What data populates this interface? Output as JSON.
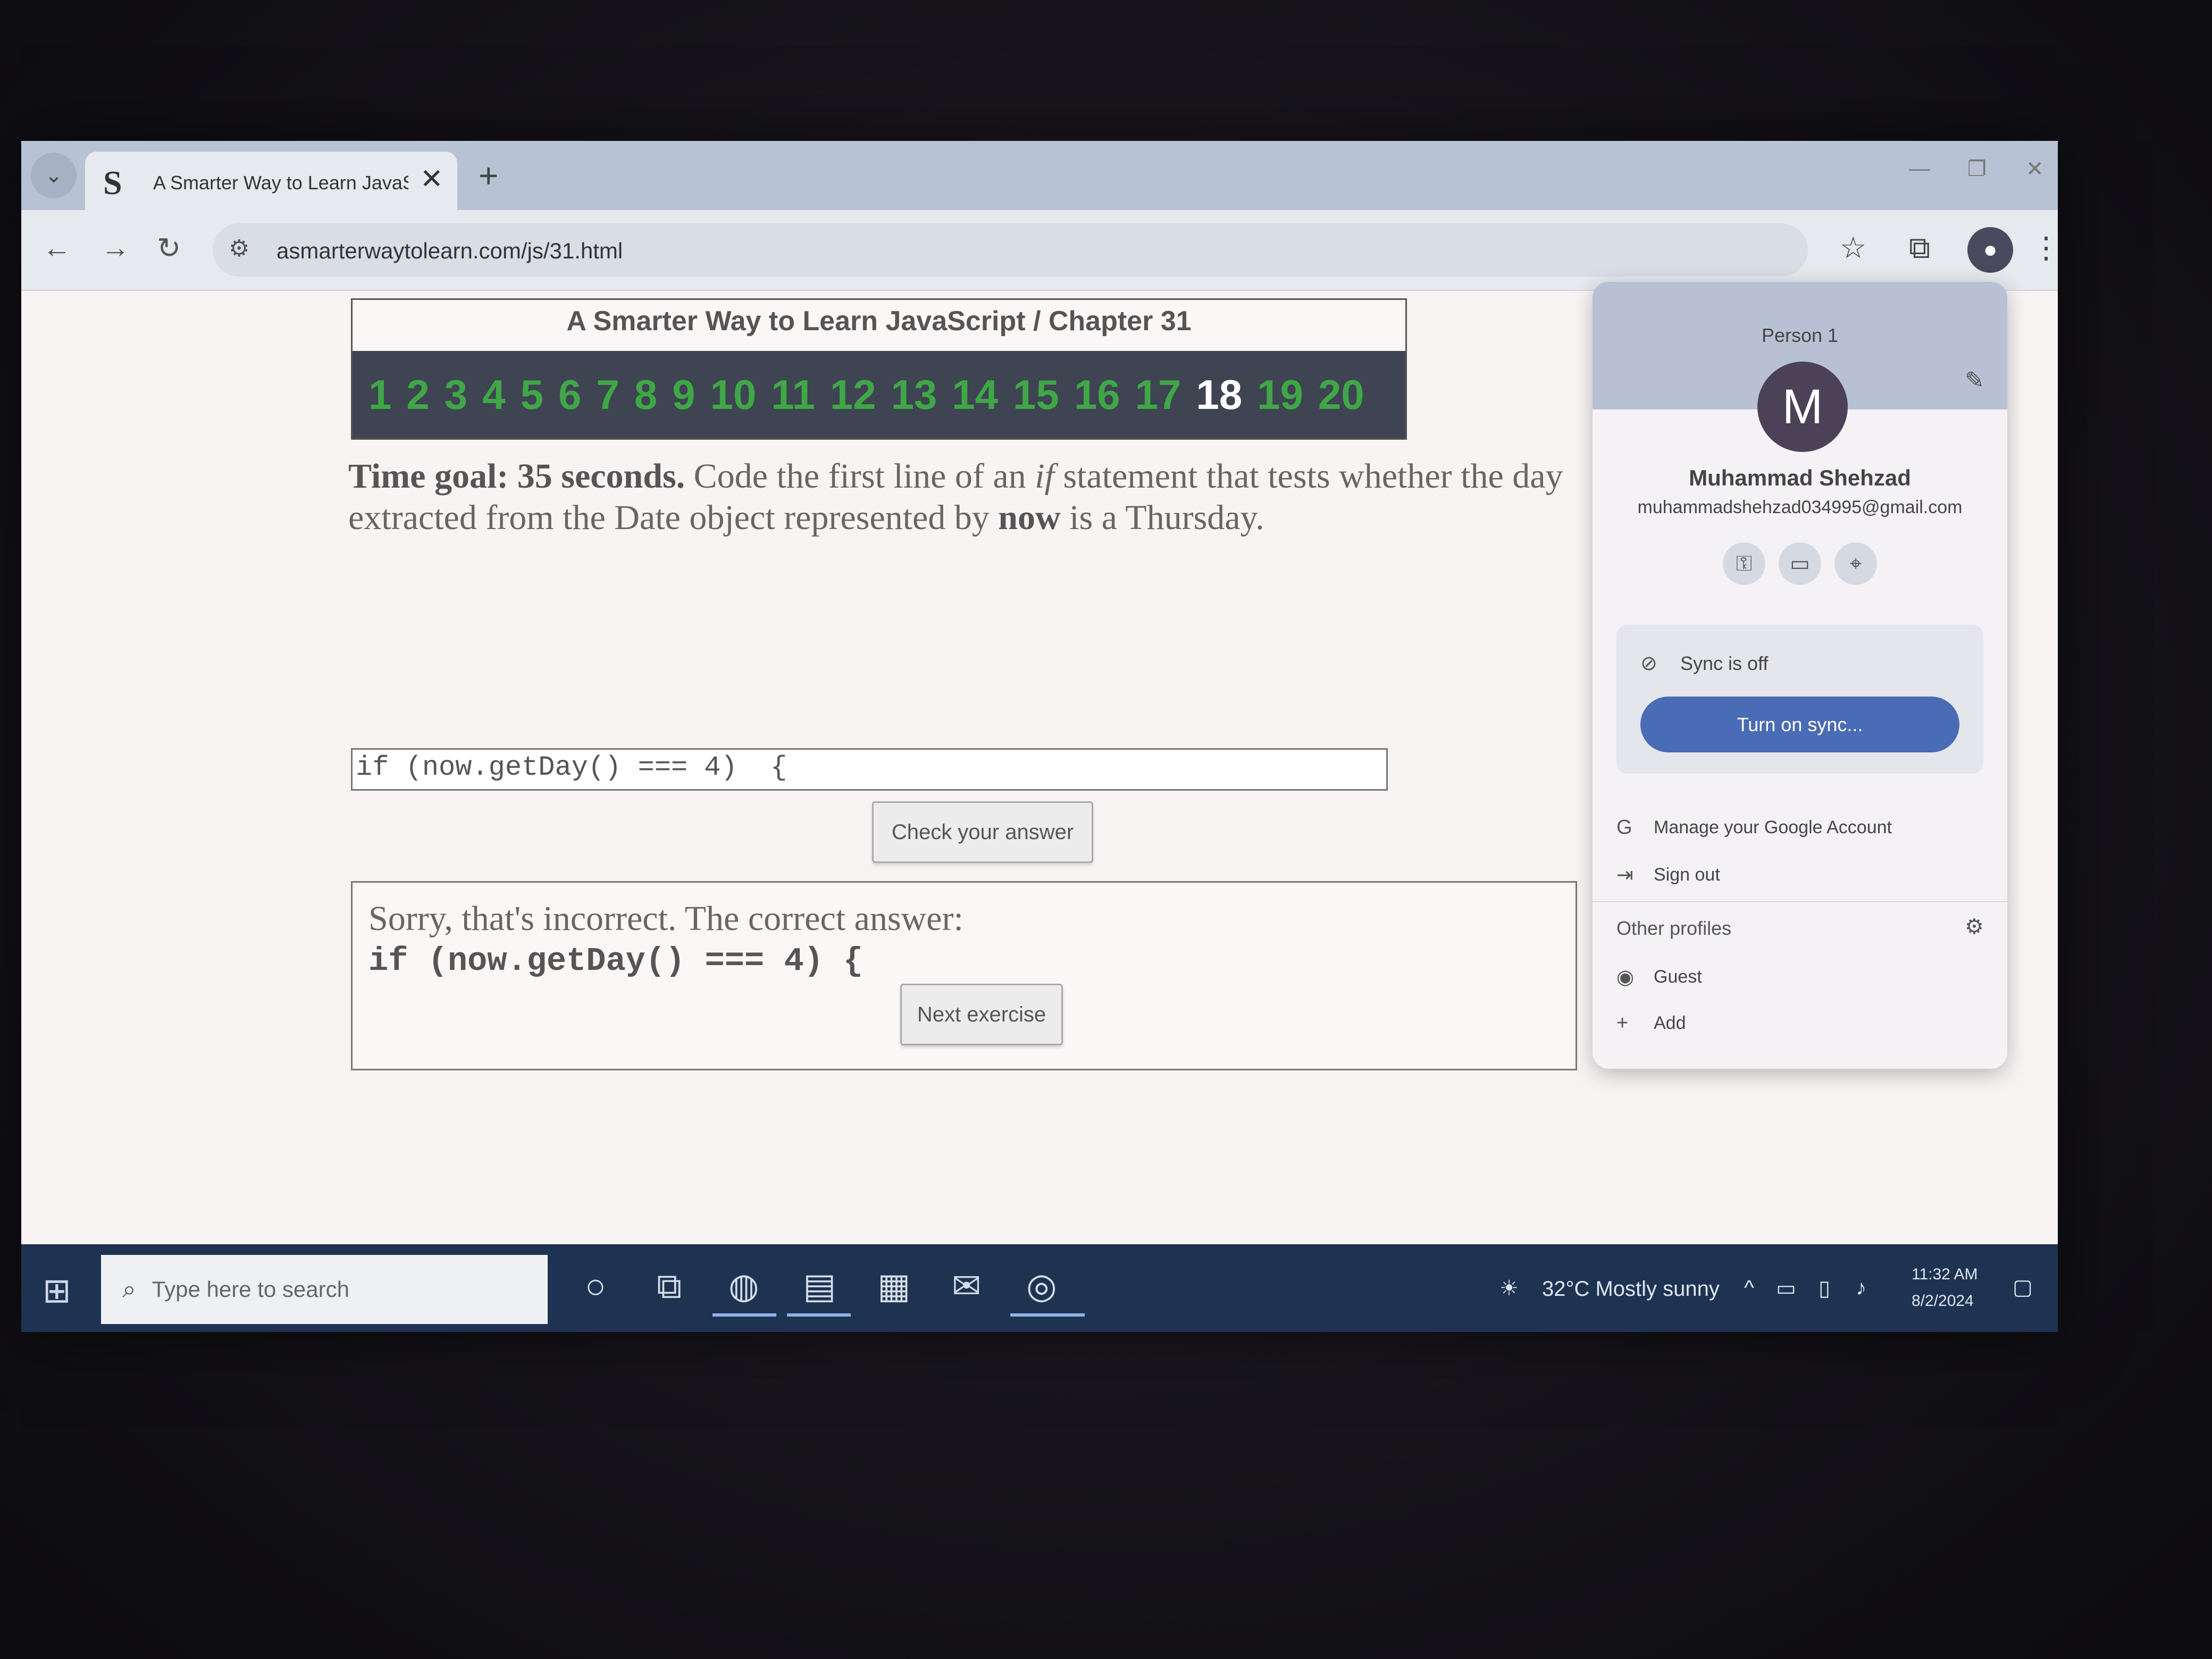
{
  "browser": {
    "tab_title": "A Smarter Way to Learn JavaScr",
    "tab_favicon": "S",
    "url": "asmarterwaytolearn.com/js/31.html"
  },
  "page": {
    "book_title": "A Smarter Way to Learn JavaScript  /  Chapter 31",
    "chapters": [
      "1",
      "2",
      "3",
      "4",
      "5",
      "6",
      "7",
      "8",
      "9",
      "10",
      "11",
      "12",
      "13",
      "14",
      "15",
      "16",
      "17",
      "18",
      "19",
      "20"
    ],
    "current_chapter": "18",
    "question": {
      "time_goal": "Time goal: 35 seconds.",
      "text_1": " Code the first line of an ",
      "if_word": "if",
      "text_2": " statement that tests whether the day extracted from the Date object represented by ",
      "now_word": "now",
      "text_3": " is a Thursday."
    },
    "answer_value": "if (now.getDay() === 4)  {",
    "check_button": "Check your answer",
    "feedback_text": "Sorry, that's incorrect. The correct answer:",
    "feedback_code": "if (now.getDay() === 4) {",
    "next_button": "Next exercise"
  },
  "profile_menu": {
    "person_label": "Person 1",
    "avatar_letter": "M",
    "name": "Muhammad Shehzad",
    "email": "muhammadshehzad034995@gmail.com",
    "sync_status": "Sync is off",
    "sync_button": "Turn on sync...",
    "manage_account": "Manage your Google Account",
    "sign_out": "Sign out",
    "other_profiles": "Other profiles",
    "guest": "Guest",
    "add": "Add"
  },
  "taskbar": {
    "search_placeholder": "Type here to search",
    "weather": "32°C  Mostly sunny",
    "time": "11:32 AM",
    "date": "8/2/2024"
  },
  "colors": {
    "chapter_link": "#3fa746",
    "chapter_bar": "#3e4452",
    "sync_button": "#4a6bb5",
    "taskbar": "#1e3352"
  }
}
